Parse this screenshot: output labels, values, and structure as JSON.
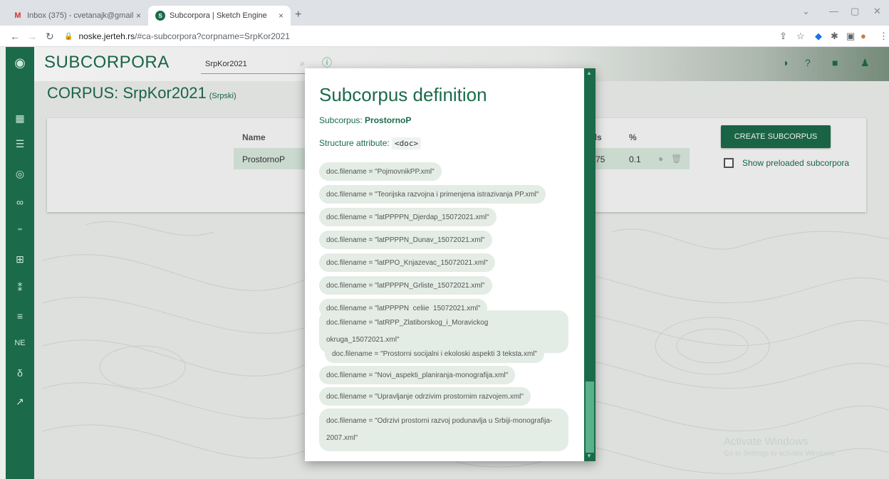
{
  "browser": {
    "tabs": [
      {
        "title": "Inbox (375) - cvetanajk@gmail.co",
        "icon": "gmail-icon"
      },
      {
        "title": "Subcorpora | Sketch Engine",
        "icon": "sketch-engine-icon"
      }
    ],
    "url_host": "noske.jerteh.rs",
    "url_rest": "/#ca-subcorpora?corpname=SrpKor2021"
  },
  "app": {
    "title": "SUBCORPORA",
    "corpus_selector": "SrpKor2021",
    "corpus_label": "CORPUS: SrpKor2021",
    "corpus_lang": "(Srpski)",
    "table": {
      "col_name": "Name",
      "col_words": "rds",
      "col_pct": "%",
      "rows": [
        {
          "name": "ProstornoP",
          "words": ",775",
          "pct": "0.1"
        }
      ]
    },
    "create_button": "CREATE SUBCORPUS",
    "show_preloaded": "Show preloaded subcorpora"
  },
  "modal": {
    "heading": "Subcorpus definition",
    "subcorpus_label": "Subcorpus: ",
    "subcorpus_name": "ProstornoP",
    "structure_label": "Structure attribute: ",
    "structure_value": "<doc>",
    "conditions": [
      "doc.filename = \"PojmovnikPP.xml\"",
      "doc.filename = \"Teorijska razvojna i primenjena istrazivanja PP.xml\"",
      "doc.filename = \"latPPPPN_Djerdap_15072021.xml\"",
      "doc.filename = \"latPPPPN_Dunav_15072021.xml\"",
      "doc.filename = \"latPPO_Knjazevac_15072021.xml\"",
      "doc.filename = \"latPPPPN_Grliste_15072021.xml\"",
      "doc.filename = \"latPPPPN_celije_15072021.xml\"",
      "doc.filename = \"latRPP_Zlatiborskog_i_Moravickog okruga_15072021.xml\"",
      "doc.filename = \"Prostorni socijalni i ekoloski aspekti 3 teksta.xml\"",
      "doc.filename = \"Novi_aspekti_planiranja-monografija.xml\"",
      "doc.filename = \"Upravljanje odrzivim prostornim razvojem.xml\"",
      "doc.filename = \"Odrzivi prostorni razvoj podunavlja u Srbiji-monografija-2007.xml\""
    ]
  },
  "os_overlay": {
    "line1": "Activate Windows",
    "line2": "Go to Settings to activate Windows."
  },
  "colors": {
    "accent": "#1b6b4a",
    "chip": "#e3ece5"
  }
}
